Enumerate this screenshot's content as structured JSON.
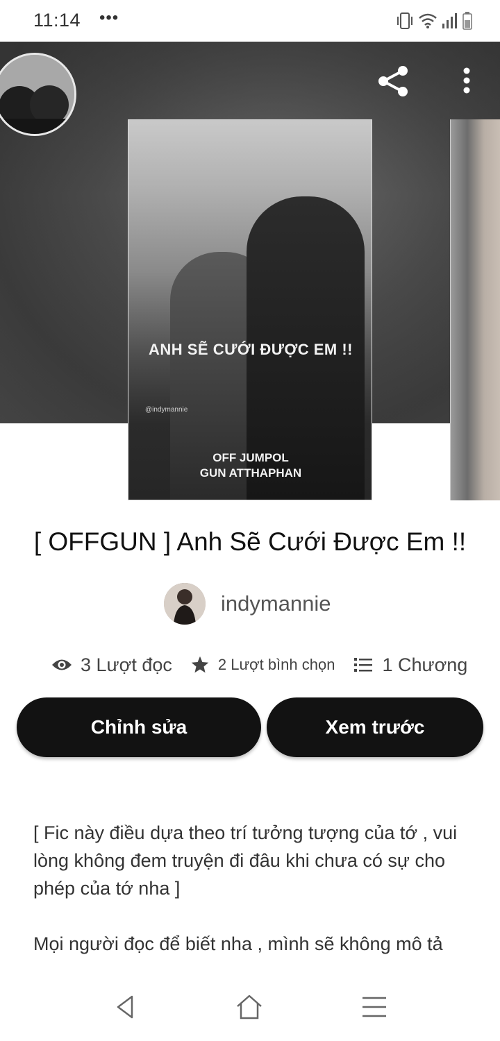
{
  "status_bar": {
    "time": "11:14",
    "notification_dots": "•••",
    "icons": [
      "vibrate-icon",
      "wifi-icon",
      "signal-icon",
      "battery-icon"
    ]
  },
  "hero": {
    "actions": [
      "share-icon",
      "more-vertical-icon"
    ]
  },
  "cover": {
    "title": "ANH SẼ CƯỚI ĐƯỢC EM !!",
    "watermark": "@indymannie",
    "names": [
      "OFF JUMPOL",
      "GUN ATTHAPHAN"
    ]
  },
  "story": {
    "title": "[ OFFGUN ] Anh Sẽ Cưới Được Em !!",
    "author": "indymannie"
  },
  "stats": {
    "reads": "3 Lượt đọc",
    "votes": "2 Lượt bình chọn",
    "chapters": "1 Chương"
  },
  "buttons": {
    "edit": "Chỉnh sửa",
    "preview": "Xem trước"
  },
  "description": {
    "p1": "[ Fic này điều dựa theo trí tưởng tượng của tớ , vui lòng không đem truyện đi đâu khi chưa có sự cho phép của tớ nha ]",
    "p2": "Mọi người đọc để biết nha , mình sẽ không mô tả"
  },
  "nav": {
    "buttons": [
      "back-icon",
      "home-icon",
      "menu-icon"
    ]
  },
  "colors": {
    "button_bg": "#121212",
    "button_text": "#ffffff",
    "text_primary": "#111111",
    "text_secondary": "#555555"
  }
}
